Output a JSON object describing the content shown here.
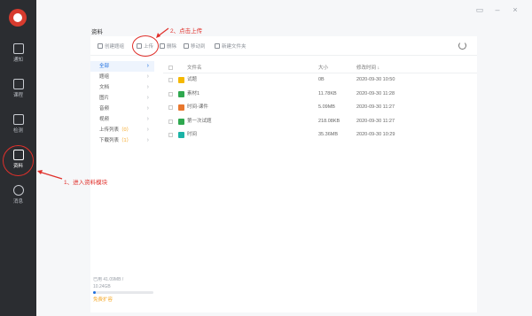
{
  "rail": {
    "items": [
      {
        "label": "通知"
      },
      {
        "label": "课程"
      },
      {
        "label": "检测"
      },
      {
        "label": "资料"
      },
      {
        "label": "消息"
      }
    ]
  },
  "page": {
    "title": "资料"
  },
  "toolbar": {
    "create_folder": "创建题组",
    "upload": "上传",
    "delete": "删除",
    "move": "移动到",
    "new_folder": "新建文件夹"
  },
  "categories": [
    {
      "label": "全部",
      "count": ""
    },
    {
      "label": "题组",
      "count": ""
    },
    {
      "label": "文档",
      "count": ""
    },
    {
      "label": "图片",
      "count": ""
    },
    {
      "label": "音频",
      "count": ""
    },
    {
      "label": "视频",
      "count": ""
    },
    {
      "label": "上传列表",
      "count": "（0）"
    },
    {
      "label": "下载列表",
      "count": "（1）"
    }
  ],
  "table": {
    "headers": {
      "name": "文件名",
      "size": "大小",
      "date": "修改时间 ↓"
    },
    "rows": [
      {
        "name": "试题",
        "size": "0B",
        "date": "2020-09-30 10:50",
        "icon": "folder-icon",
        "color": "#f5b800"
      },
      {
        "name": "素材1",
        "size": "11.78KB",
        "date": "2020-09-30 11:28",
        "icon": "image-file-icon",
        "color": "#2fa84f"
      },
      {
        "name": "时间-课件",
        "size": "5.09MB",
        "date": "2020-09-30 11:27",
        "icon": "ppt-file-icon",
        "color": "#e8772e"
      },
      {
        "name": "第一次试题",
        "size": "218.08KB",
        "date": "2020-09-30 11:27",
        "icon": "image-file-icon",
        "color": "#2fa84f"
      },
      {
        "name": "时间",
        "size": "35.36MB",
        "date": "2020-09-30 10:29",
        "icon": "video-file-icon",
        "color": "#1bb3a6"
      }
    ]
  },
  "storage": {
    "used": "已用 41.09MB /",
    "total": "10.24GB",
    "fill_fraction": 0.04,
    "expand": "免费扩容"
  },
  "annotations": {
    "step1": "1、进入资料模块",
    "step2": "2、点击上传"
  }
}
